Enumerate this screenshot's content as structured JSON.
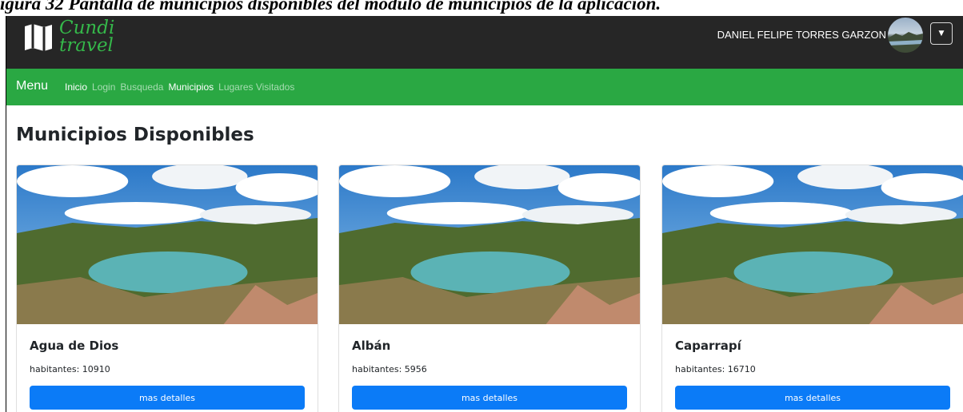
{
  "document": {
    "caption": "igura 32 Pantalla de municipios disponibles del modulo de municipios de la aplicación."
  },
  "header": {
    "logo_text_line1": "Cundi",
    "logo_text_line2": "travel",
    "user_name": "DANIEL FELIPE TORRES GARZON",
    "dropdown_icon": "caret-down-icon"
  },
  "menu": {
    "title": "Menu",
    "items": [
      {
        "label": "Inicio",
        "active": true
      },
      {
        "label": "Login",
        "active": false
      },
      {
        "label": "Busqueda",
        "active": false
      },
      {
        "label": "Municipios",
        "active": true
      },
      {
        "label": "Lugares Visitados",
        "active": false
      }
    ]
  },
  "main": {
    "title": "Municipios Disponibles",
    "cards": [
      {
        "name": "Agua de Dios",
        "habitantes": "habitantes: 10910",
        "button": "mas detalles"
      },
      {
        "name": "Albán",
        "habitantes": "habitantes: 5956",
        "button": "mas detalles"
      },
      {
        "name": "Caparrapí",
        "habitantes": "habitantes: 16710",
        "button": "mas detalles"
      }
    ]
  },
  "colors": {
    "topbar": "#262626",
    "menubar": "#2aa843",
    "brand_green": "#35b84a",
    "button_blue": "#0b7bf7"
  }
}
